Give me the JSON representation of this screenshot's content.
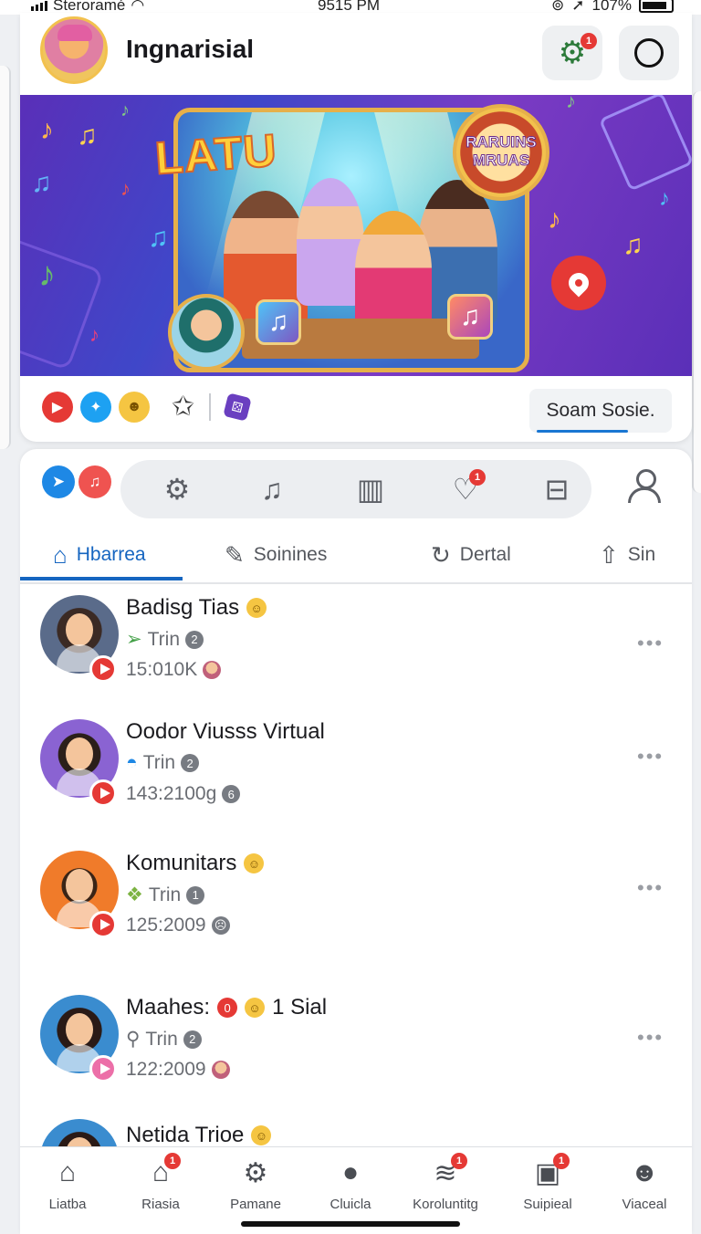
{
  "status_bar": {
    "carrier": "Steroramé",
    "time": "9515 PM",
    "battery": "107%"
  },
  "header": {
    "name": "Ingnarisial",
    "gear_badge": "1"
  },
  "banner": {
    "title": "LATU",
    "logo_text": "RARUINS MRUAS"
  },
  "search": {
    "label": "Soam Sosie."
  },
  "colors": {
    "accent": "#1565c0",
    "badge": "#e53935",
    "play": "#e53935"
  },
  "icon_bar": {
    "heart_badge": "1"
  },
  "tabs": [
    {
      "label": "Hbarrea",
      "icon": "home-icon"
    },
    {
      "label": "Soinines",
      "icon": "feather-icon"
    },
    {
      "label": "Dertal",
      "icon": "refresh-icon"
    },
    {
      "label": "Sin",
      "icon": "share-icon"
    }
  ],
  "feed": [
    {
      "name": "Badisg Tias",
      "sub": "Trin",
      "sub_count": "2",
      "meta": "15:010K"
    },
    {
      "name": "Oodor Viusss Virtual",
      "sub": "Trin",
      "sub_count": "2",
      "meta": "143:2100g",
      "meta_count": "6"
    },
    {
      "name": "Komunitars",
      "sub": "Trin",
      "sub_count": "1",
      "meta": "125:2009"
    },
    {
      "name": "Maahes:",
      "name_extra": "1 Sial",
      "sub": "Trin",
      "sub_count": "2",
      "meta": "122:2009"
    },
    {
      "name": "Netida Trioe"
    }
  ],
  "bottom_nav": [
    {
      "label": "Liatba",
      "icon": "home-icon"
    },
    {
      "label": "Riasia",
      "icon": "house-camera-icon",
      "badge": "1"
    },
    {
      "label": "Pamane",
      "icon": "settings-box-icon"
    },
    {
      "label": "Cluicla",
      "icon": "person-icon"
    },
    {
      "label": "Koroluntitg",
      "icon": "stack-icon",
      "badge": "1"
    },
    {
      "label": "Suipieal",
      "icon": "photo-icon",
      "badge": "1"
    },
    {
      "label": "Viaceal",
      "icon": "user-icon"
    }
  ]
}
